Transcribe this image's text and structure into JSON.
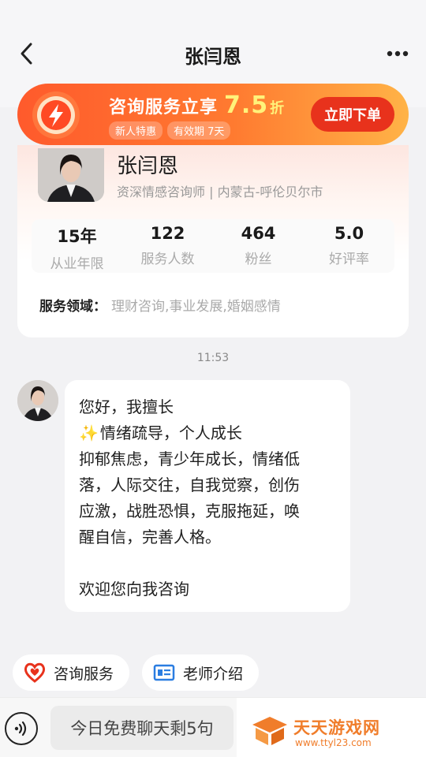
{
  "header": {
    "title": "张闫恩"
  },
  "promo": {
    "title": "咨询服务立享",
    "discount": "7.5",
    "discount_unit": "折",
    "tags": [
      "新人特惠",
      "有效期 7天"
    ],
    "cta": "立即下单"
  },
  "counselor": {
    "name": "张闫恩",
    "subtitle": "资深情感咨询师 | 内蒙古-呼伦贝尔市",
    "stats": [
      {
        "value": "15年",
        "label": "从业年限"
      },
      {
        "value": "122",
        "label": "服务人数"
      },
      {
        "value": "464",
        "label": "粉丝"
      },
      {
        "value": "5.0",
        "label": "好评率"
      }
    ],
    "domain_label": "服务领域：",
    "domain_value": "理财咨询,事业发展,婚姻感情"
  },
  "chat": {
    "time": "11:53",
    "message": {
      "line1": "您好，我擅长",
      "line2": "情绪疏导，个人成长",
      "line3": "抑郁焦虑，青少年成长，情绪低",
      "line4": "落，人际交往，自我觉察，创伤",
      "line5": "应激，战胜恐惧，克服拖延，唤",
      "line6": "醒自信，完善人格。",
      "line7": "欢迎您向我咨询"
    }
  },
  "quick_actions": [
    {
      "label": "咨询服务",
      "icon": "heart-icon"
    },
    {
      "label": "老师介绍",
      "icon": "id-card-icon"
    }
  ],
  "bottom_bar": {
    "input_text": "今日免费聊天剩5句"
  },
  "watermark": {
    "name": "天天游戏网",
    "url": "www.ttyl23.com"
  },
  "colors": {
    "accent": "#e8321c",
    "promo_start": "#ff5a2c",
    "promo_end": "#ffb347",
    "discount": "#fff27a",
    "watermark": "#f07d2b"
  }
}
